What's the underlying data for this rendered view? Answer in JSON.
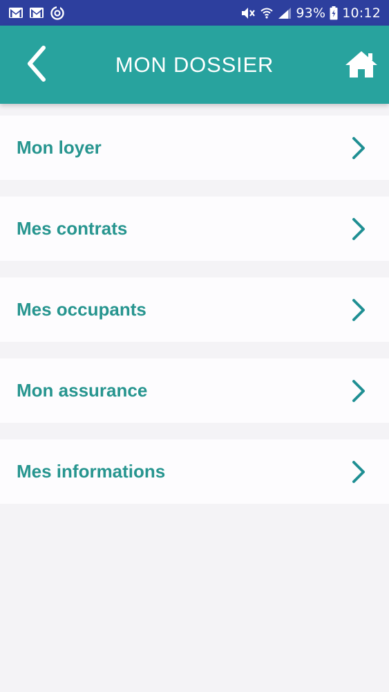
{
  "status_bar": {
    "icons_left": [
      "gmail-icon",
      "gmail-icon",
      "sync-icon"
    ],
    "icons_right": [
      "mute-icon",
      "wifi-icon",
      "signal-icon"
    ],
    "battery": "93%",
    "time": "10:12"
  },
  "app_bar": {
    "title": "MON DOSSIER",
    "back_icon": "chevron-left-icon",
    "home_icon": "home-icon",
    "color": "#28a39e"
  },
  "menu": {
    "items": [
      {
        "label": "Mon loyer"
      },
      {
        "label": "Mes contrats"
      },
      {
        "label": "Mes occupants"
      },
      {
        "label": "Mon assurance"
      },
      {
        "label": "Mes informations"
      }
    ],
    "label_color": "#27958f"
  }
}
